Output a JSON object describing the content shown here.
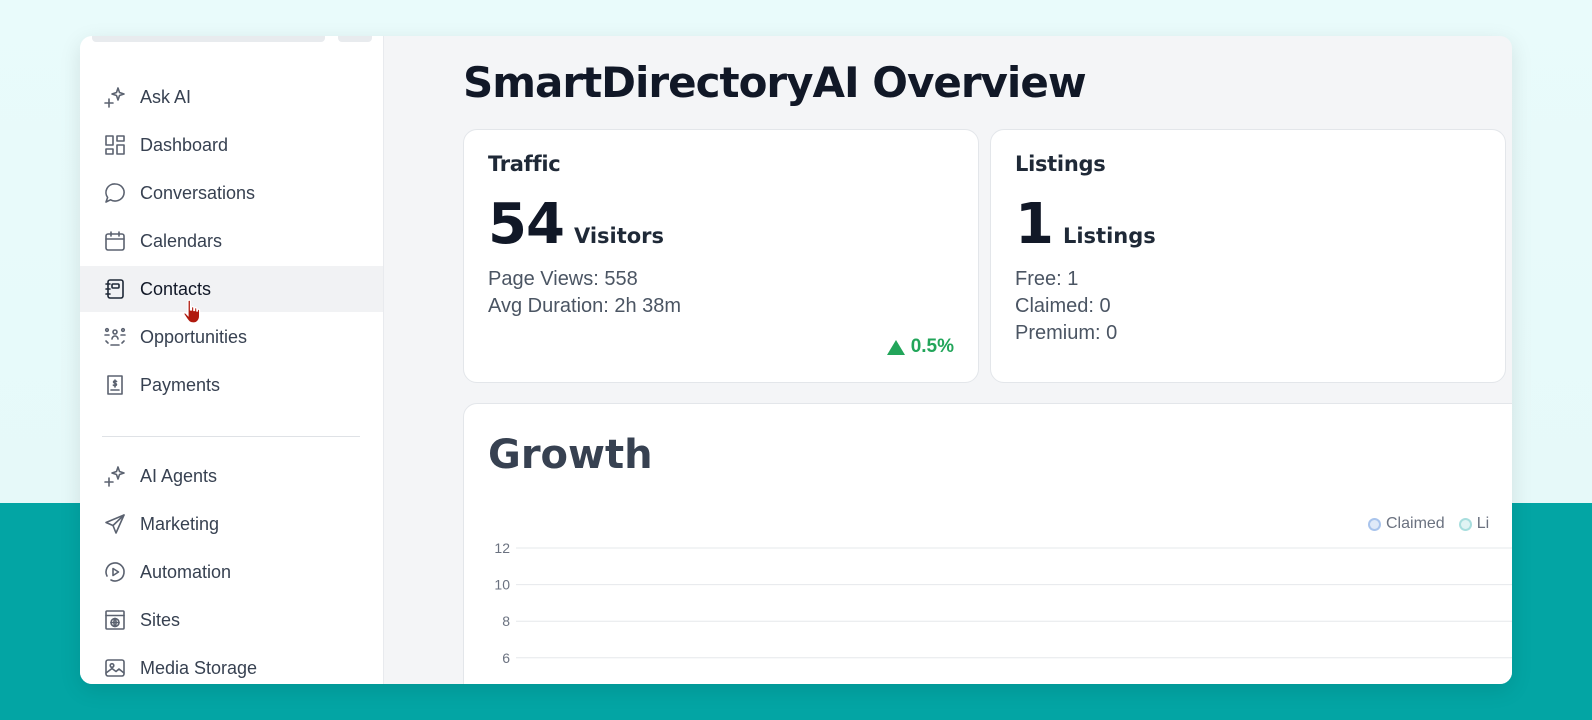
{
  "sidebar": {
    "items": [
      {
        "label": "Ask AI",
        "icon": "sparkle-icon"
      },
      {
        "label": "Dashboard",
        "icon": "grid-icon"
      },
      {
        "label": "Conversations",
        "icon": "chat-bubble-icon"
      },
      {
        "label": "Calendars",
        "icon": "calendar-icon"
      },
      {
        "label": "Contacts",
        "icon": "contact-book-icon",
        "active": true
      },
      {
        "label": "Opportunities",
        "icon": "opportunities-icon"
      },
      {
        "label": "Payments",
        "icon": "receipt-icon"
      }
    ],
    "items2": [
      {
        "label": "AI Agents",
        "icon": "sparkle-icon"
      },
      {
        "label": "Marketing",
        "icon": "send-icon"
      },
      {
        "label": "Automation",
        "icon": "play-circle-icon"
      },
      {
        "label": "Sites",
        "icon": "globe-window-icon"
      },
      {
        "label": "Media Storage",
        "icon": "image-icon"
      }
    ]
  },
  "page": {
    "title": "SmartDirectoryAI Overview"
  },
  "traffic": {
    "title": "Traffic",
    "count": "54",
    "unit": "Visitors",
    "page_views": "Page Views: 558",
    "avg_duration": "Avg Duration: 2h 38m",
    "trend": "0.5%",
    "trend_color": "#22a55a"
  },
  "listings": {
    "title": "Listings",
    "count": "1",
    "unit": "Listings",
    "free": "Free: 1",
    "claimed": "Claimed: 0",
    "premium": "Premium: 0"
  },
  "growth": {
    "title": "Growth",
    "legend": [
      {
        "label": "Claimed",
        "color": "#a9c4ec"
      },
      {
        "label": "Li",
        "color": "#a8dede"
      }
    ]
  },
  "chart_data": {
    "type": "line",
    "title": "Growth",
    "y_ticks": [
      12,
      10,
      8,
      6
    ],
    "ylim": [
      6,
      12
    ],
    "series": [
      {
        "name": "Claimed",
        "values": []
      },
      {
        "name": "Li",
        "values": []
      }
    ],
    "grid": true,
    "legend_position": "top-right"
  }
}
